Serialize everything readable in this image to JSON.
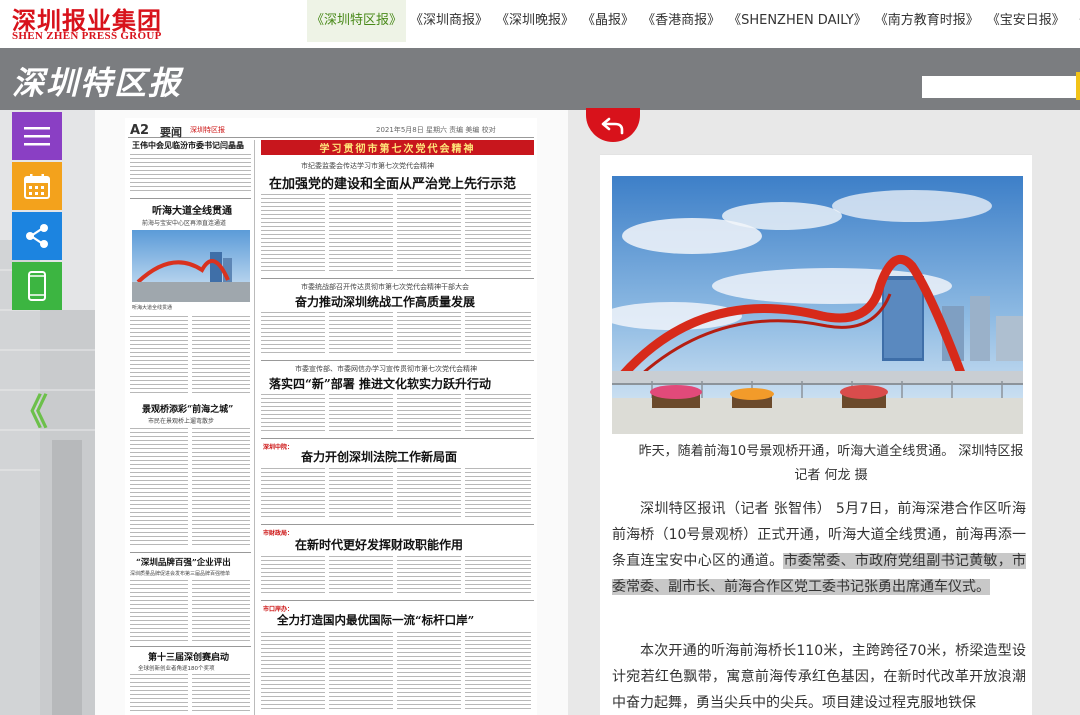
{
  "header": {
    "logo_cn": "深圳报业集团",
    "logo_en": "SHEN ZHEN PRESS GROUP",
    "nav": [
      "《深圳特区报》",
      "《深圳商报》",
      "《深圳晚报》",
      "《晶报》",
      "《香港商报》",
      "《SHENZHEN DAILY》",
      "《南方教育时报》",
      "《宝安日报》",
      "《经"
    ],
    "active_index": 0
  },
  "banner": {
    "title": "深圳特区报",
    "search_placeholder": ""
  },
  "sidebar": {
    "buttons": [
      "menu-icon",
      "calendar-icon",
      "share-icon",
      "mobile-icon"
    ],
    "prev_label": "《"
  },
  "newspaper": {
    "page_no": "A2",
    "section": "要闻",
    "masthead_small": "深圳特区报",
    "meta": "2021年5月8日 星期六 责编 美编 校对",
    "left_col": {
      "h1": "王伟中会见临汾市委书记闫晶晶",
      "h2": "听海大道全线贯通",
      "h2_sub": "前海与宝安中心区再添直连通道",
      "h3": "景观桥添彩“前海之城”",
      "h3_sub": "市民在景观桥上遛弯散步",
      "h4": "“深圳品牌百强”企业评出",
      "h4_sub": "深圳质量品牌促进会发布第三届品牌百强榜单",
      "h5": "第十三届深创赛启动",
      "h5_sub": "全球创新创业者角逐180个奖项"
    },
    "right_col": {
      "banner": "学习贯彻市第七次党代会精神",
      "kicker1": "市纪委监委会传达学习市第七次党代会精神",
      "h1": "在加强党的建设和全面从严治党上先行示范",
      "kicker2": "市委统战部召开传达贯彻市第七次党代会精神干部大会",
      "h2": "奋力推动深圳统战工作高质量发展",
      "kicker3": "市委宣传部、市委网信办学习宣传贯彻市第七次党代会精神",
      "h3": "落实四“新”部署 推进文化软实力跃升行动",
      "tag4": "深圳中院：",
      "h4": "奋力开创深圳法院工作新局面",
      "tag5": "市财政局：",
      "h5": "在新时代更好发挥财政职能作用",
      "tag6": "市口岸办：",
      "h6": "全力打造国内最优国际一流“标杆口岸”"
    }
  },
  "article": {
    "caption": "昨天，随着前海10号景观桥开通，听海大道全线贯通。 深圳特区报记者 何龙 摄",
    "p1_a": "深圳特区报讯（记者 张智伟） 5月7日，前海深港合作区听海前海桥（10号景观桥）正式开通，听海大道全线贯通，前海再添一条直连宝安中心区的通道。",
    "p1_sel": "市委常委、市政府党组副书记黄敏，市委常委、副市长、前海合作区党工委书记张勇出席通车仪式。",
    "p2": "本次开通的听海前海桥长110米，主跨跨径70米，桥梁造型设计宛若红色飘带，寓意前海传承红色基因，在新时代改革开放浪潮中奋力起舞，勇当尖兵中的尖兵。项目建设过程克服地铁保"
  },
  "colors": {
    "brand_red": "#d8121b",
    "banner_gray": "#7b7d80",
    "nav_active_green": "#4a8a1a",
    "menu_purple": "#8a3fc4",
    "calendar_orange": "#f3a21c",
    "share_blue": "#1c84e0",
    "mobile_green": "#3cb541"
  }
}
